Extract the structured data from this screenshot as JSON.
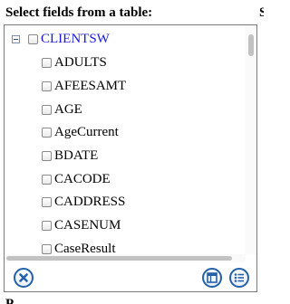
{
  "title": "Select fields from a table:",
  "tree": {
    "root_label": "CLIENTSW",
    "root_color": "#1a1adf",
    "expanded": true,
    "items": [
      {
        "label": "ADULTS"
      },
      {
        "label": "AFEESAMT"
      },
      {
        "label": "AGE"
      },
      {
        "label": "AgeCurrent"
      },
      {
        "label": "BDATE"
      },
      {
        "label": "CACODE"
      },
      {
        "label": "CADDRESS"
      },
      {
        "label": "CASENUM"
      },
      {
        "label": "CaseResult"
      }
    ]
  },
  "toolbar": {
    "cancel_icon": "close-circle-icon",
    "table_icon": "table-view-icon",
    "list_icon": "list-view-icon",
    "accent_color": "#2461a8"
  },
  "edge_right_text": "S",
  "bottom_text": "P"
}
